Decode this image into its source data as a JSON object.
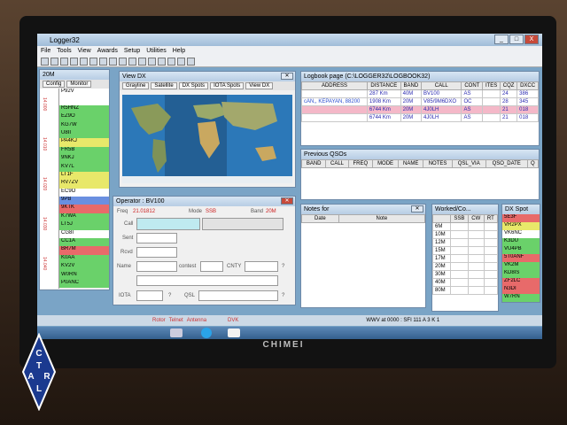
{
  "window": {
    "title": "Logger32",
    "buttons": [
      "_",
      "□",
      "X"
    ]
  },
  "menu": [
    "File",
    "Tools",
    "View",
    "Awards",
    "Setup",
    "Utilities",
    "Help"
  ],
  "bandmap": {
    "title": "20M",
    "tabs": [
      "Config",
      "Monitor"
    ],
    "spots": [
      {
        "call": "P92V",
        "color": "#ffffff"
      },
      {
        "call": "",
        "color": "#ffffff"
      },
      {
        "call": "R5HNZ",
        "color": "#6ad16a"
      },
      {
        "call": "EZ9O",
        "color": "#6ad16a"
      },
      {
        "call": "KG7W",
        "color": "#6ad16a"
      },
      {
        "call": "U8II",
        "color": "#6ad16a"
      },
      {
        "call": "PA4KJ",
        "color": "#e8e86a"
      },
      {
        "call": "FR5B",
        "color": "#6ad16a"
      },
      {
        "call": "9NKJ",
        "color": "#6ad16a"
      },
      {
        "call": "KV7L",
        "color": "#6ad16a"
      },
      {
        "call": "LT1F",
        "color": "#e8e86a"
      },
      {
        "call": "RV7ZV",
        "color": "#e8e86a"
      },
      {
        "call": "EC9O",
        "color": "#ffffff"
      },
      {
        "call": "9PB",
        "color": "#6a8fe0"
      },
      {
        "call": "9KTK",
        "color": "#e86a6a"
      },
      {
        "call": "K7WA",
        "color": "#6ad16a"
      },
      {
        "call": "LT5J",
        "color": "#6ad16a"
      },
      {
        "call": "CG8I",
        "color": "#ffffff"
      },
      {
        "call": "CC1A",
        "color": "#6ad16a"
      },
      {
        "call": "BR7M",
        "color": "#e86a6a"
      },
      {
        "call": "K0AA",
        "color": "#6ad16a"
      },
      {
        "call": "KV2V",
        "color": "#6ad16a"
      },
      {
        "call": "W0RN",
        "color": "#6ad16a"
      },
      {
        "call": "P0ANC",
        "color": "#6ad16a"
      }
    ],
    "freqs": [
      "14.000",
      "14.010",
      "14.020",
      "14.030",
      "14.040"
    ]
  },
  "viewdx": {
    "title": "View DX",
    "tabs": [
      "Grayline",
      "Satellite",
      "DX Spots",
      "IOTA Spots",
      "View DX"
    ]
  },
  "logbook": {
    "title": "Logbook page (C:\\LOGGER32\\LOGBOOK32)",
    "columns": [
      "ADDRESS",
      "DISTANCE",
      "BAND",
      "CALL",
      "CONT",
      "ITES",
      "CQZ",
      "DXCC"
    ],
    "rows": [
      {
        "address": "",
        "distance": "287 Km",
        "band": "40M",
        "call": "BV100",
        "cont": "AS",
        "ites": "",
        "cqz": "24",
        "dxcc": "386",
        "bg": "#ffffff"
      },
      {
        "address": "cAN,, KEPAYAN, 88200",
        "distance": "1908 Km",
        "band": "20M",
        "call": "V85/9M6DXO",
        "cont": "OC",
        "ites": "",
        "cqz": "28",
        "dxcc": "345",
        "bg": "#ffffff"
      },
      {
        "address": "",
        "distance": "6744 Km",
        "band": "20M",
        "call": "4J0LH",
        "cont": "AS",
        "ites": "",
        "cqz": "21",
        "dxcc": "018",
        "bg": "#f4b8c8"
      },
      {
        "address": "",
        "distance": "6744 Km",
        "band": "20M",
        "call": "4J0LH",
        "cont": "AS",
        "ites": "",
        "cqz": "21",
        "dxcc": "018",
        "bg": "#ffffff"
      }
    ]
  },
  "previous": {
    "title": "Previous QSOs",
    "columns": [
      "BAND",
      "CALL",
      "FREQ",
      "MODE",
      "NAME",
      "NOTES",
      "QSL_VIA",
      "QSO_DATE",
      "Q"
    ]
  },
  "operator": {
    "title": "Operator : BV100",
    "freq_label": "Freq",
    "freq": "21.01812",
    "mode_label": "Mode",
    "mode": "SSB",
    "band_label": "Band",
    "band": "20M",
    "labels": {
      "call": "Call",
      "sent": "Sent",
      "rcvd": "Rcvd",
      "name": "Name",
      "contest": "contest",
      "cnty": "CNTY",
      "iota": "IOTA",
      "qsl": "QSL",
      "q": "?"
    }
  },
  "notes": {
    "title": "Notes for",
    "columns": [
      "Date",
      "Note"
    ]
  },
  "worked": {
    "title": "Worked/Co...",
    "columns": [
      "SSB",
      "CW",
      "RT"
    ],
    "bands": [
      "6M",
      "10M",
      "12M",
      "15M",
      "17M",
      "20M",
      "30M",
      "40M",
      "80M"
    ]
  },
  "dxspot": {
    "title": "DX Spot",
    "spots": [
      {
        "call": "5E3F",
        "color": "#e86a6a"
      },
      {
        "call": "VR2PX",
        "color": "#e8e86a"
      },
      {
        "call": "VK6NC",
        "color": "#ffffff"
      },
      {
        "call": "K3DU",
        "color": "#6ad16a"
      },
      {
        "call": "VU4PB",
        "color": "#6ad16a"
      },
      {
        "call": "5T0ANF",
        "color": "#e86a6a"
      },
      {
        "call": "VK2M",
        "color": "#6ad16a"
      },
      {
        "call": "KD8IS",
        "color": "#6ad16a"
      },
      {
        "call": "ZF2LC",
        "color": "#e86a6a"
      },
      {
        "call": "N3DI",
        "color": "#e86a6a"
      },
      {
        "call": "W7RN",
        "color": "#6ad16a"
      }
    ]
  },
  "statusbar": {
    "items": [
      "Rotor",
      "Telnet",
      "Antenna",
      "DVK"
    ],
    "wwv": "WWV at 0000 : SFI 111 A 3 K 1"
  },
  "monitor_brand": "CHIMEI",
  "sticker": {
    "letters": [
      "C",
      "T",
      "A",
      "R",
      "L"
    ]
  },
  "colors": {
    "accent_red": "#e02020",
    "freq_red": "#cc2020"
  }
}
